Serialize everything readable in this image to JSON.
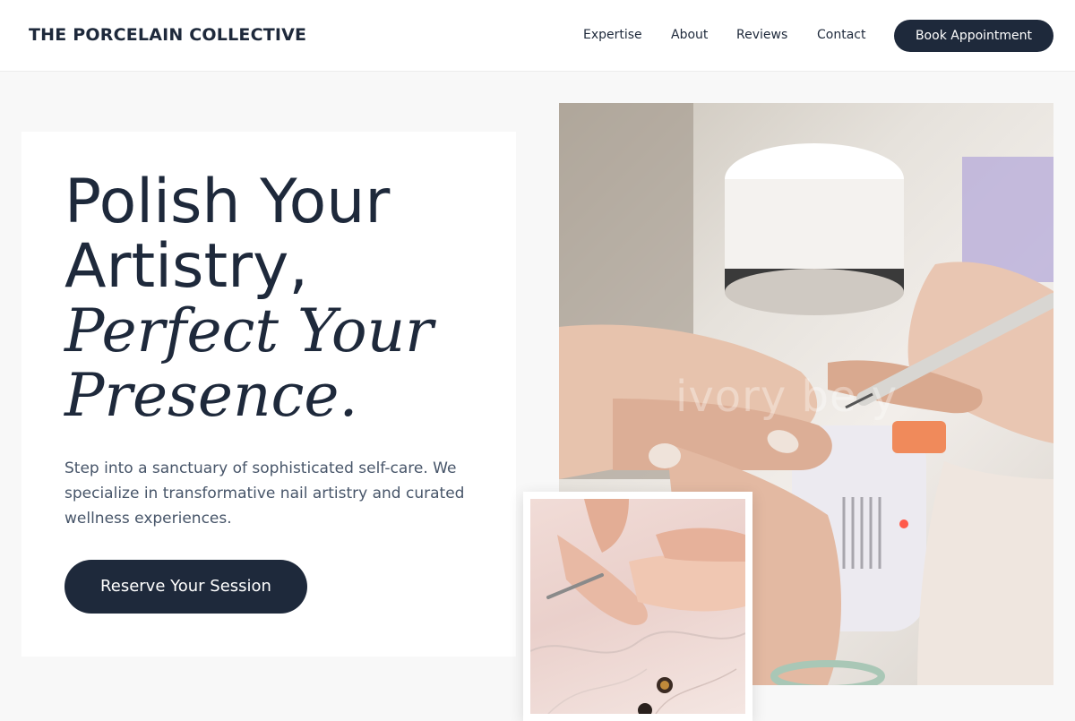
{
  "header": {
    "brand": "THE PORCELAIN COLLECTIVE",
    "nav": [
      "Expertise",
      "About",
      "Reviews",
      "Contact"
    ],
    "cta_label": "Book Appointment"
  },
  "hero": {
    "title_line1": "Polish Your",
    "title_line2": "Artistry,",
    "title_line3": "Perfect Your",
    "title_line4": "Presence.",
    "description": "Step into a sanctuary of sophisticated self-care. We specialize in transformative nail artistry and curated wellness experiences.",
    "cta_label": "Reserve Your Session"
  },
  "images": {
    "main_watermark": "ivory be   y",
    "main_alt": "manicure-photo",
    "secondary_alt": "nail-care-photo"
  },
  "colors": {
    "primary": "#1e293b",
    "background": "#f8f8f8",
    "body_text": "#475569"
  }
}
